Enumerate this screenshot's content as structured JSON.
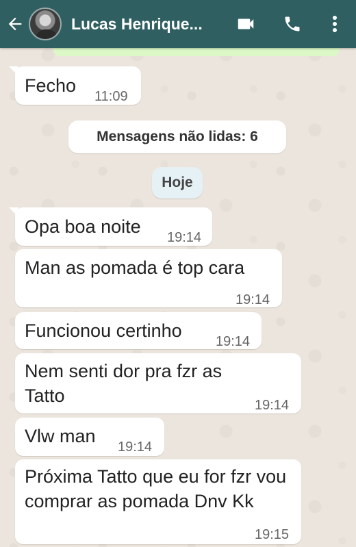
{
  "header": {
    "contact_name": "Lucas Henrique...",
    "back_icon": "arrow-left-icon",
    "video_icon": "video-call-icon",
    "phone_icon": "phone-icon",
    "menu_icon": "more-vertical-icon",
    "bar_color": "#2f5f61"
  },
  "messages": [
    {
      "text": "Fecho",
      "time": "11:09"
    },
    {
      "text": "Opa boa noite",
      "time": "19:14"
    },
    {
      "text": "Man as pomada é top cara",
      "time": "19:14"
    },
    {
      "text": "Funcionou certinho",
      "time": "19:14"
    },
    {
      "text": "Nem senti dor pra fzr as Tatto",
      "time": "19:14"
    },
    {
      "text": "Vlw man",
      "time": "19:14"
    },
    {
      "text": "Próxima Tatto que eu for fzr vou comprar as pomada Dnv Kk",
      "time": "19:15"
    }
  ],
  "unread_banner": "Mensagens não lidas: 6",
  "day_separator": "Hoje",
  "colors": {
    "background": "#ece5dd",
    "incoming_bubble": "#ffffff",
    "outgoing_bubble": "#dcf8c6"
  }
}
